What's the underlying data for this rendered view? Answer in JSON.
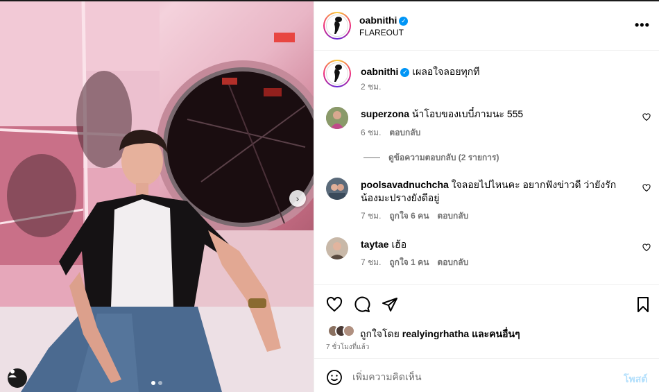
{
  "post": {
    "author": "oabnithi",
    "location": "FLAREOUT",
    "caption": "เผลอใจลอยทุกที",
    "caption_time": "2 ชม.",
    "more_label": "•••",
    "verified_mark": "✓"
  },
  "carousel": {
    "next_label": "›",
    "slides": 2,
    "active": 0
  },
  "comments": [
    {
      "username": "superzona",
      "text": "น้าโอบของเบบี๋ภามนะ 555",
      "time": "6 ชม.",
      "likes": "",
      "reply_label": "ตอบกลับ",
      "avatar_color": "#9b7b6a"
    },
    {
      "username": "poolsavadnuchcha",
      "text": "ใจลอยไปไหนคะ อยากฟังข่าวดี ว่ายังรักน้องมะปรางยังดีอยู่",
      "time": "7 ชม.",
      "likes": "ถูกใจ 6 คน",
      "reply_label": "ตอบกลับ",
      "avatar_color": "#6f7f8f"
    },
    {
      "username": "taytae",
      "text": "เฮ้อ",
      "time": "7 ชม.",
      "likes": "ถูกใจ 1 คน",
      "reply_label": "ตอบกลับ",
      "avatar_color": "#a98f7a"
    }
  ],
  "view_replies": "ดูข้อความตอบกลับ (2 รายการ)",
  "likes": {
    "prefix": "ถูกใจโดย",
    "user": "realyingrhatha",
    "and": "และ",
    "others": "คนอื่นๆ"
  },
  "post_time": "7 ชั่วโมงที่แล้ว",
  "comment_box": {
    "placeholder": "เพิ่มความคิดเห็น",
    "post_label": "โพสต์"
  },
  "icons": {
    "like": "heart-icon",
    "comment": "comment-bubble-icon",
    "share": "paper-plane-icon",
    "save": "bookmark-icon",
    "emoji": "emoji-smile-icon",
    "tag": "user-tag-icon"
  },
  "colors": {
    "verified": "#0095f6",
    "post_button": "#b2dffc",
    "meta_text": "#737373"
  }
}
